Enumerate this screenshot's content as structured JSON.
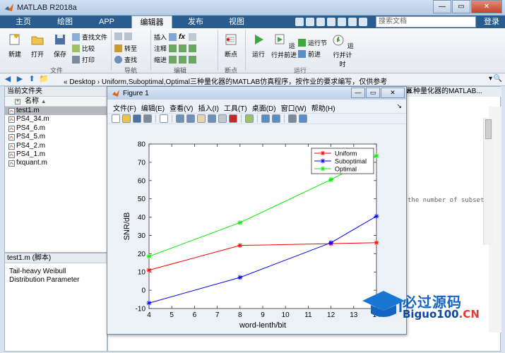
{
  "window": {
    "title": "MATLAB R2018a",
    "close_glyph": "✕",
    "min_glyph": "—",
    "max_glyph": "▭"
  },
  "tabs": [
    "主页",
    "绘图",
    "APP",
    "编辑器",
    "发布",
    "视图"
  ],
  "active_tab": "编辑器",
  "search_placeholder": "搜索文档",
  "login_label": "登录",
  "ribbon": {
    "file_group": {
      "label": "文件",
      "new": "新建",
      "open": "打开",
      "save": "保存",
      "find_files": "查找文件",
      "compare": "比较",
      "print": "打印"
    },
    "nav_group": {
      "label": "导航",
      "goto": "转至",
      "find": "查找"
    },
    "edit_group": {
      "label": "编辑",
      "insert": "插入",
      "comment": "注释",
      "indent": "缩进",
      "fx": "fx"
    },
    "breakpoint_group": {
      "label": "断点",
      "breakpoints": "断点"
    },
    "run_group": {
      "label": "运行",
      "run": "运行",
      "run_advance": "运行并前进",
      "run_section": "运行节",
      "advance": "前进",
      "run_time": "运行并计时"
    }
  },
  "address": {
    "path": "« Desktop  ›  Uniform,Suboptimal,Optimal三种量化器的MATLAB仿真程序，按作业的要求编写，仅供参考",
    "dropdown": "▾",
    "search": "🔍"
  },
  "current_folder": {
    "header": "当前文件夹",
    "column": "名称",
    "sort_indicator": "▲",
    "files": [
      "test1.m",
      "PS4_34.m",
      "PS4_6.m",
      "PS4_5.m",
      "PS4_2.m",
      "PS4_1.m",
      "fxquant.m"
    ]
  },
  "details": {
    "header": "test1.m  (脚本)",
    "description": "Tail-heavy Weibull Distribution Parameter"
  },
  "editor": {
    "tab": "三种量化器的MATLAB...",
    "code_fragment": "the number of subset"
  },
  "figure": {
    "title": "Figure 1",
    "menu": [
      "文件(F)",
      "编辑(E)",
      "查看(V)",
      "插入(I)",
      "工具(T)",
      "桌面(D)",
      "窗口(W)",
      "帮助(H)"
    ],
    "tools": [
      "new-figure-icon",
      "open-icon",
      "save-icon",
      "print-icon",
      "sep",
      "select-icon",
      "sep",
      "zoom-in-icon",
      "zoom-out-icon",
      "pan-icon",
      "rotate-icon",
      "data-cursor-icon",
      "brush-icon",
      "sep",
      "link-icon",
      "sep",
      "colorbar-icon",
      "legend-icon",
      "sep",
      "hide-tools-icon",
      "show-tools-icon"
    ]
  },
  "chart_data": {
    "type": "line",
    "xlabel": "word-lenth/bit",
    "ylabel": "SNR/dB",
    "xlim": [
      4,
      14
    ],
    "ylim": [
      -10,
      80
    ],
    "xticks": [
      4,
      5,
      6,
      7,
      8,
      9,
      10,
      11,
      12,
      13,
      14
    ],
    "yticks": [
      -10,
      0,
      10,
      20,
      30,
      40,
      50,
      60,
      70,
      80
    ],
    "grid": false,
    "legend_position": "top-right",
    "series": [
      {
        "name": "Uniform",
        "color": "#ff0000",
        "x": [
          4,
          8,
          12,
          14
        ],
        "y": [
          11,
          24.5,
          25.5,
          26
        ]
      },
      {
        "name": "Suboptimal",
        "color": "#0000ff",
        "x": [
          4,
          8,
          12,
          14
        ],
        "y": [
          -7,
          7,
          26,
          40.5
        ]
      },
      {
        "name": "Optimal",
        "color": "#00ee00",
        "x": [
          4,
          8,
          12,
          14
        ],
        "y": [
          18.5,
          37,
          60.5,
          73.5
        ]
      }
    ]
  },
  "watermark": {
    "title": "必过源码",
    "url": "Biguo100",
    "tld": ".CN"
  }
}
